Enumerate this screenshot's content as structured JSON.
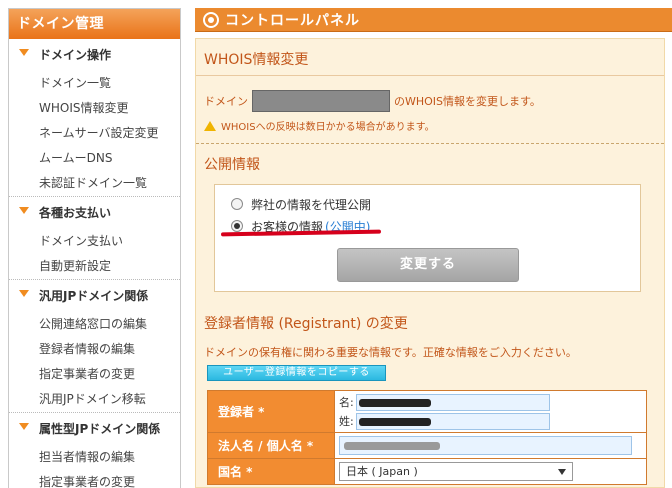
{
  "sidebar": {
    "title": "ドメイン管理",
    "sections": [
      {
        "title": "ドメイン操作",
        "items": [
          "ドメイン一覧",
          "WHOIS情報変更",
          "ネームサーバ設定変更",
          "ムームーDNS",
          "未認証ドメイン一覧"
        ]
      },
      {
        "title": "各種お支払い",
        "items": [
          "ドメイン支払い",
          "自動更新設定"
        ]
      },
      {
        "title": "汎用JPドメイン関係",
        "items": [
          "公開連絡窓口の編集",
          "登録者情報の編集",
          "指定事業者の変更",
          "汎用JPドメイン移転"
        ]
      },
      {
        "title": "属性型JPドメイン関係",
        "items": [
          "担当者情報の編集",
          "指定事業者の変更"
        ]
      }
    ]
  },
  "header": {
    "title": "コントロールパネル",
    "icon": "gear-icon"
  },
  "whois": {
    "title": "WHOIS情報変更",
    "domain_prefix": "ドメイン",
    "domain_suffix": "のWHOIS情報を変更します。",
    "warning": "WHOISへの反映は数日かかる場合があります。"
  },
  "public_info": {
    "title": "公開情報",
    "option_proxy": "弊社の情報を代理公開",
    "option_customer": "お客様の情報",
    "option_customer_status": "(公開中)",
    "change_button": "変更する"
  },
  "registrant": {
    "title": "登録者情報 (Registrant) の変更",
    "description": "ドメインの保有権に関わる重要な情報です。正確な情報をご入力ください。",
    "copy_button": "ユーザー登録情報をコピーする",
    "rows": [
      {
        "label": "登録者 *",
        "first_name_label": "名:",
        "last_name_label": "姓:"
      },
      {
        "label": "法人名 / 個人名 *"
      },
      {
        "label": "国名 *",
        "value": "日本 ( Japan )"
      }
    ]
  },
  "colors": {
    "accent": "#eb8a2f",
    "panel_bg": "#fdf2dc",
    "text_accent": "#c2561a",
    "link": "#2a7fd4"
  }
}
